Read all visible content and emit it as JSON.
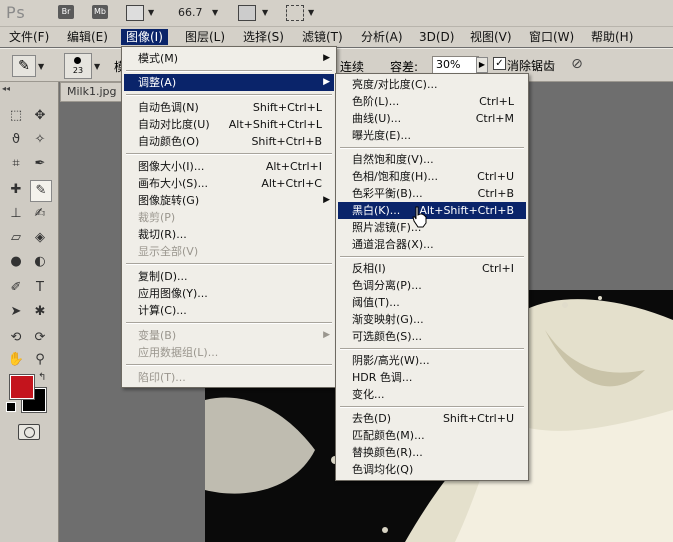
{
  "app": {
    "logo": "Ps",
    "bridge_btn": "Br",
    "minibridge_btn": "Mb",
    "zoom": "66.7"
  },
  "menubar": [
    "文件(F)",
    "编辑(E)",
    "图像(I)",
    "图层(L)",
    "选择(S)",
    "滤镜(T)",
    "分析(A)",
    "3D(D)",
    "视图(V)",
    "窗口(W)",
    "帮助(H)"
  ],
  "options": {
    "brush_size": "23",
    "tolerance_label": "容差:",
    "tolerance_value": "30%",
    "antialias_label": "消除锯齿",
    "partial_left": "连续",
    "partial_char": "模"
  },
  "document": {
    "tab_title": "Milk1.jpg"
  },
  "image_menu": {
    "items": [
      {
        "label": "模式(M)",
        "submenu": true
      },
      {
        "label": "调整(A)",
        "submenu": true,
        "highlight": true
      },
      {
        "label": "自动色调(N)",
        "shortcut": "Shift+Ctrl+L"
      },
      {
        "label": "自动对比度(U)",
        "shortcut": "Alt+Shift+Ctrl+L"
      },
      {
        "label": "自动颜色(O)",
        "shortcut": "Shift+Ctrl+B"
      },
      {
        "label": "图像大小(I)...",
        "shortcut": "Alt+Ctrl+I"
      },
      {
        "label": "画布大小(S)...",
        "shortcut": "Alt+Ctrl+C"
      },
      {
        "label": "图像旋转(G)",
        "submenu": true
      },
      {
        "label": "裁剪(P)",
        "disabled": true
      },
      {
        "label": "裁切(R)..."
      },
      {
        "label": "显示全部(V)",
        "disabled": true
      },
      {
        "label": "复制(D)..."
      },
      {
        "label": "应用图像(Y)..."
      },
      {
        "label": "计算(C)..."
      },
      {
        "label": "变量(B)",
        "submenu": true,
        "disabled": true
      },
      {
        "label": "应用数据组(L)...",
        "disabled": true
      },
      {
        "label": "陷印(T)...",
        "disabled": true
      }
    ]
  },
  "adjust_menu": {
    "items": [
      {
        "label": "亮度/对比度(C)..."
      },
      {
        "label": "色阶(L)...",
        "shortcut": "Ctrl+L"
      },
      {
        "label": "曲线(U)...",
        "shortcut": "Ctrl+M"
      },
      {
        "label": "曝光度(E)..."
      },
      {
        "label": "自然饱和度(V)..."
      },
      {
        "label": "色相/饱和度(H)...",
        "shortcut": "Ctrl+U"
      },
      {
        "label": "色彩平衡(B)...",
        "shortcut": "Ctrl+B"
      },
      {
        "label": "黑白(K)...",
        "shortcut": "Alt+Shift+Ctrl+B",
        "highlight": true
      },
      {
        "label": "照片滤镜(F)..."
      },
      {
        "label": "通道混合器(X)..."
      },
      {
        "label": "反相(I)",
        "shortcut": "Ctrl+I"
      },
      {
        "label": "色调分离(P)..."
      },
      {
        "label": "阈值(T)..."
      },
      {
        "label": "渐变映射(G)..."
      },
      {
        "label": "可选颜色(S)..."
      },
      {
        "label": "阴影/高光(W)..."
      },
      {
        "label": "HDR 色调..."
      },
      {
        "label": "变化..."
      },
      {
        "label": "去色(D)",
        "shortcut": "Shift+Ctrl+U"
      },
      {
        "label": "匹配颜色(M)..."
      },
      {
        "label": "替换颜色(R)..."
      },
      {
        "label": "色调均化(Q)"
      }
    ]
  },
  "colors": {
    "foreground": "#c4141d",
    "background": "#000000",
    "highlight": "#0a246a"
  }
}
